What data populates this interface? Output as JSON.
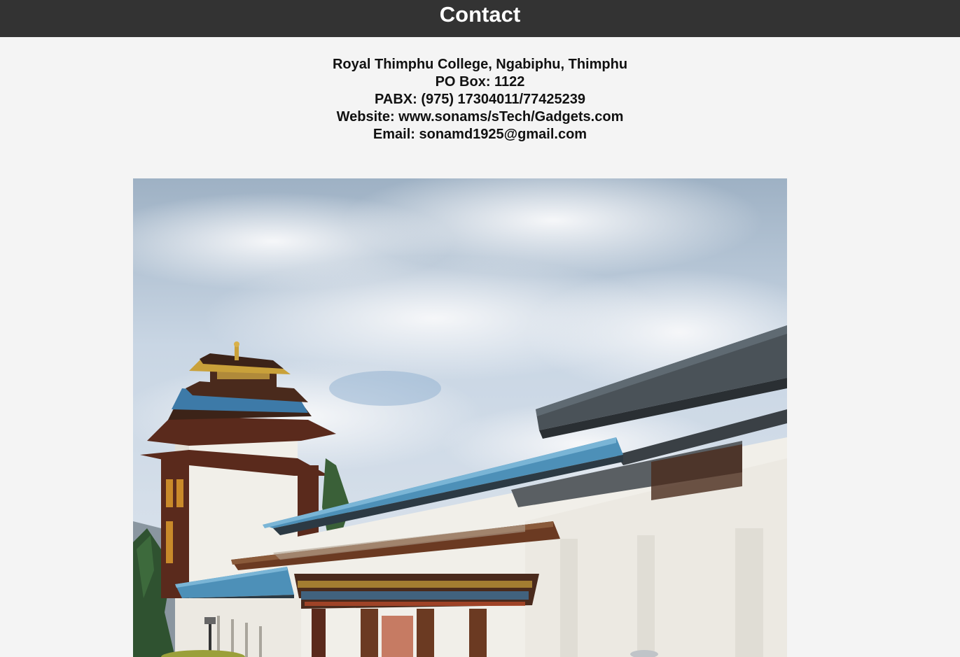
{
  "header": {
    "title": "Contact"
  },
  "contact": {
    "address": "Royal Thimphu College, Ngabiphu, Thimphu",
    "po_box": "PO Box: 1122",
    "pabx": "PABX: (975) 17304011/77425239",
    "website": "Website: www.sonams/sTech/Gadgets.com",
    "email": "Email: sonamd1925@gmail.com"
  },
  "photo": {
    "subject": "campus-building-photo",
    "colors": {
      "sky": "#c9d6e4",
      "cloud": "#eef1f5",
      "wall": "#f1efe9",
      "roof_blue": "#4d90b8",
      "roof_grey": "#4a5258",
      "wood": "#5a2a1c",
      "gold": "#c9a13a",
      "tree": "#2f5230"
    }
  }
}
